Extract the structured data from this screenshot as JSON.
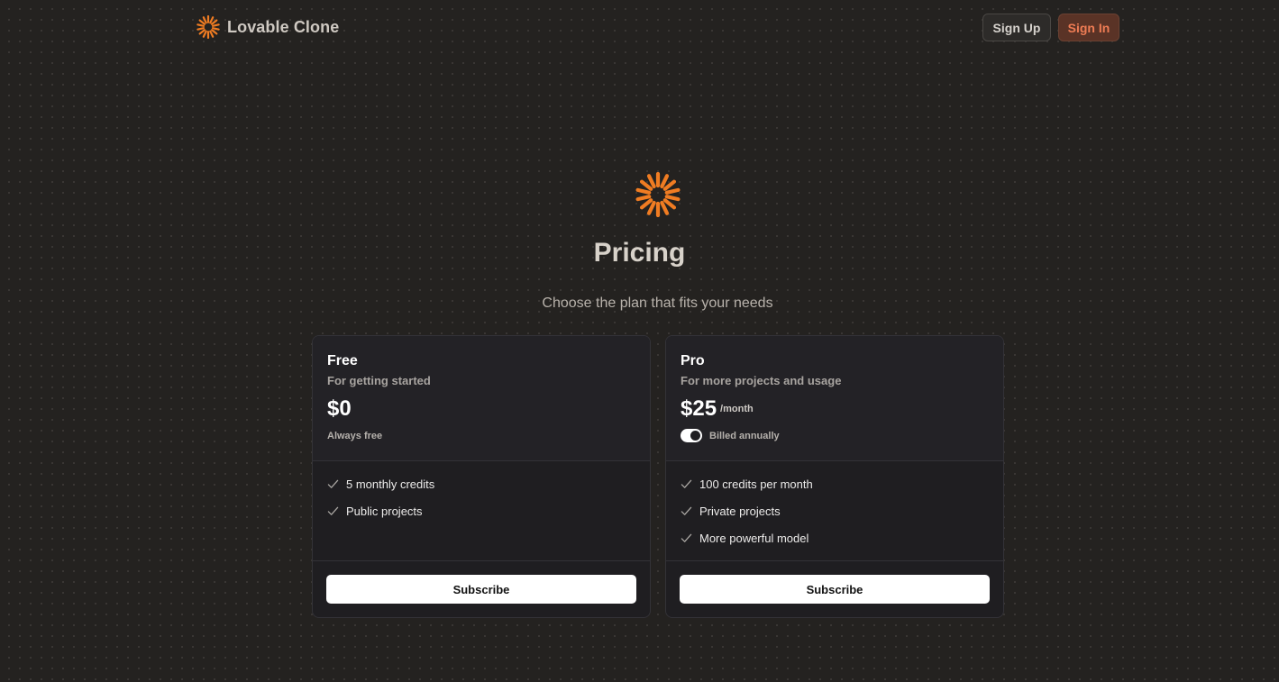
{
  "nav": {
    "brand": "Lovable Clone",
    "brand_icon": "sunburst-logo-icon",
    "signup_label": "Sign Up",
    "signin_label": "Sign In"
  },
  "hero": {
    "icon": "sunburst-logo-icon",
    "title": "Pricing",
    "subtitle": "Choose the plan that fits your needs"
  },
  "plans": [
    {
      "name": "Free",
      "description": "For getting started",
      "price": "$0",
      "note": "Always free",
      "features": [
        "5 monthly credits",
        "Public projects"
      ],
      "button": "Subscribe"
    },
    {
      "name": "Pro",
      "description": "For more projects and usage",
      "price": "$25",
      "period": "/month",
      "toggle_label": "Billed annually",
      "toggle_on": true,
      "features": [
        "100 credits per month",
        "Private projects",
        "More powerful model"
      ],
      "button": "Subscribe"
    }
  ],
  "colors": {
    "accent": "#f07c22",
    "background": "#242220",
    "card": "#1f1e21",
    "signin_text": "#ee7c54"
  }
}
